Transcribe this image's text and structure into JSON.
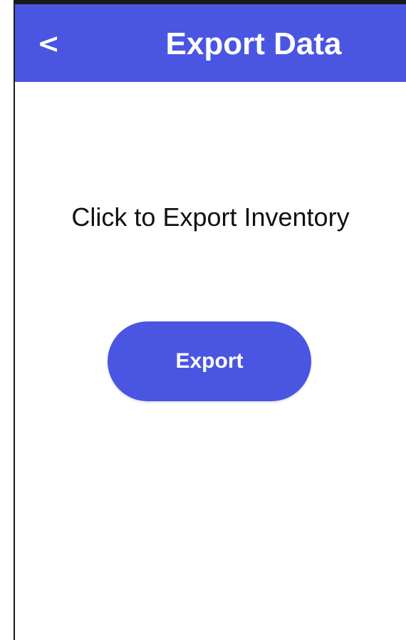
{
  "header": {
    "back_label": "<",
    "title": "Export Data"
  },
  "main": {
    "prompt": "Click to Export Inventory",
    "export_label": "Export"
  },
  "colors": {
    "accent": "#4a56e2",
    "background": "#ffffff",
    "text": "#111111",
    "on_accent": "#ffffff"
  }
}
